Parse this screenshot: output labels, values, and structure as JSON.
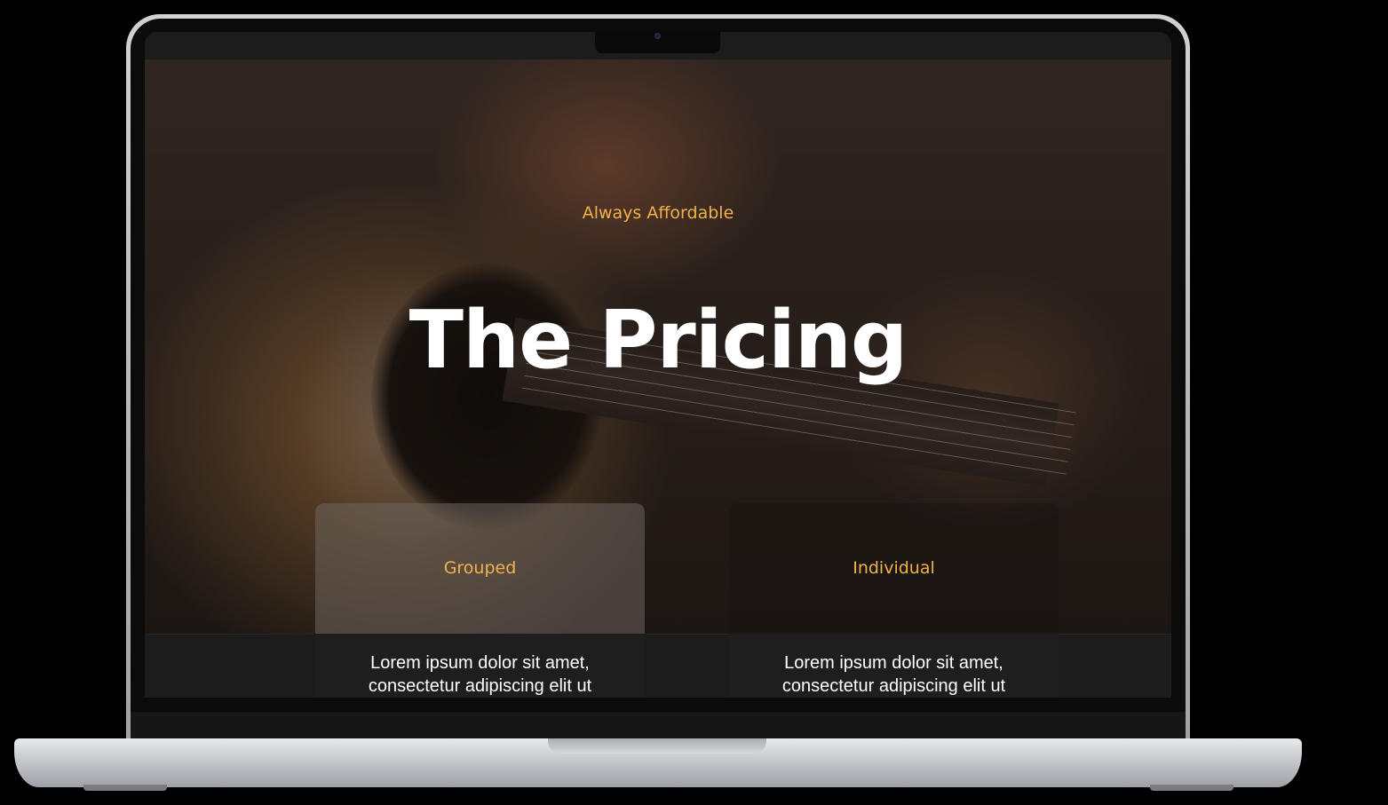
{
  "page": {
    "eyebrow": "Always Affordable",
    "title": "The Pricing"
  },
  "cards": [
    {
      "title": "Grouped",
      "text_line_1": "Lorem ipsum dolor sit amet,",
      "text_line_2": "consectetur adipiscing elit ut"
    },
    {
      "title": "Individual",
      "text_line_1": "Lorem ipsum dolor sit amet,",
      "text_line_2": "consectetur adipiscing elit ut"
    }
  ],
  "colors": {
    "accent": "#f2b24a",
    "text": "#ffffff",
    "background": "#1c1c1c"
  },
  "icons": [
    "camera-icon"
  ]
}
